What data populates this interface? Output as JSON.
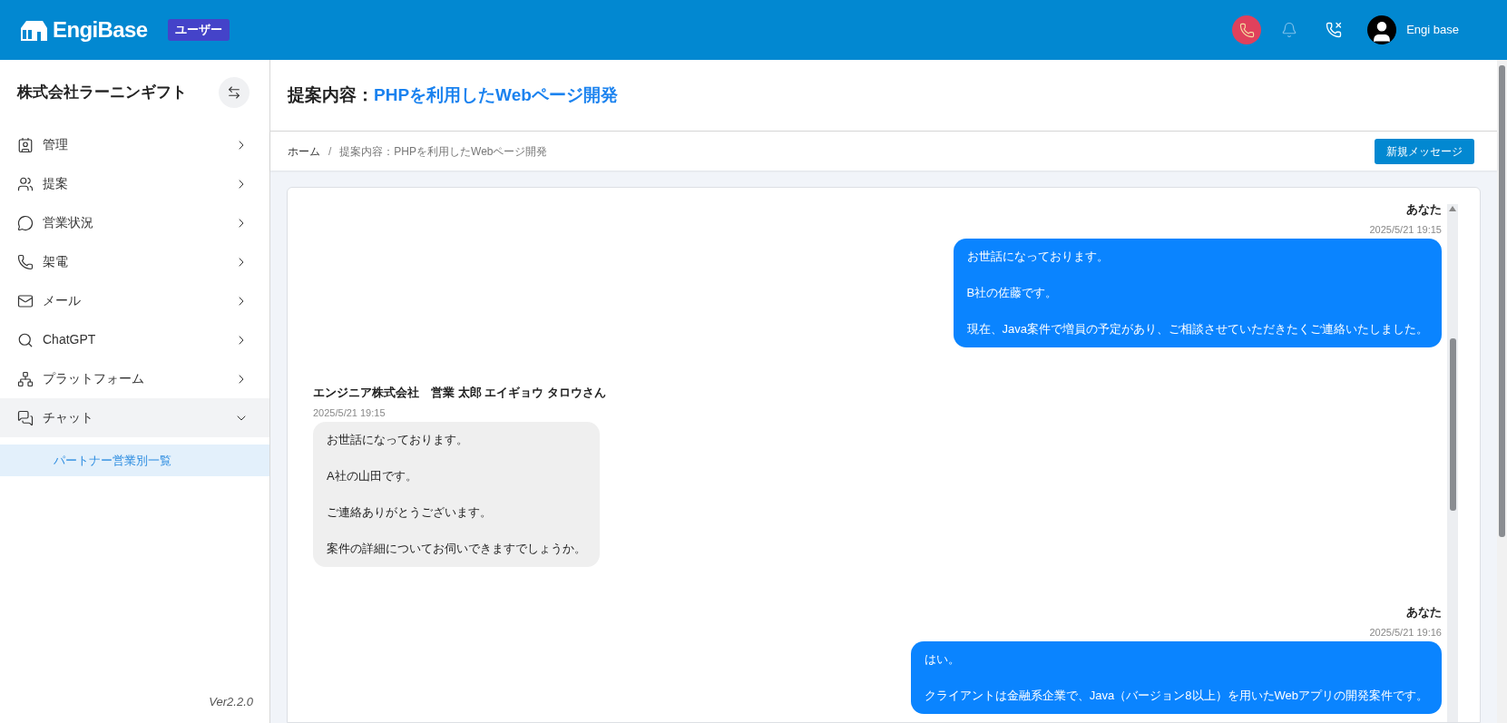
{
  "header": {
    "logo": "EngiBase",
    "role_badge": "ユーザー",
    "user_name": "Engi base"
  },
  "sidebar": {
    "company": "株式会社ラーニンギフト",
    "items": [
      {
        "label": "管理",
        "expanded": false
      },
      {
        "label": "提案",
        "expanded": false
      },
      {
        "label": "営業状況",
        "expanded": false
      },
      {
        "label": "架電",
        "expanded": false
      },
      {
        "label": "メール",
        "expanded": false
      },
      {
        "label": "ChatGPT",
        "expanded": false
      },
      {
        "label": "プラットフォーム",
        "expanded": false
      },
      {
        "label": "チャット",
        "expanded": true,
        "children": [
          {
            "label": "パートナー営業別一覧",
            "selected": true
          }
        ]
      }
    ],
    "version": "Ver2.2.0"
  },
  "page": {
    "title_label": "提案内容：",
    "title_value": "PHPを利用したWebページ開発",
    "breadcrumb": [
      "ホーム",
      "提案内容：PHPを利用したWebページ開発"
    ],
    "breadcrumb_separator": "/",
    "new_message_button": "新規メッセージ"
  },
  "messages": [
    {
      "kind": "mine",
      "sender": "あなた",
      "time": "2025/5/21 19:15",
      "paragraphs": [
        "お世話になっております。",
        "B社の佐藤です。",
        "現在、Java案件で増員の予定があり、ご相談させていただきたくご連絡いたしました。"
      ]
    },
    {
      "kind": "theirs",
      "sender": "エンジニア株式会社　営業 太郎 エイギョウ タロウさん",
      "time": "2025/5/21 19:15",
      "paragraphs": [
        "お世話になっております。",
        "A社の山田です。",
        "ご連絡ありがとうございます。",
        "案件の詳細についてお伺いできますでしょうか。"
      ]
    },
    {
      "kind": "mine",
      "sender": "あなた",
      "time": "2025/5/21 19:16",
      "paragraphs": [
        "はい。",
        "クライアントは金融系企業で、Java（バージョン8以上）を用いたWebアプリの開発案件です。"
      ]
    }
  ]
}
